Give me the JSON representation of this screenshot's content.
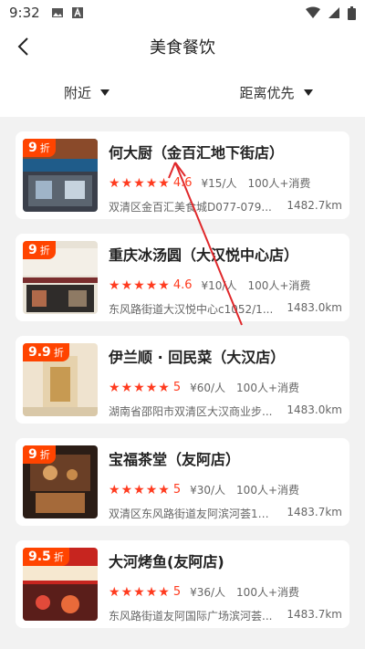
{
  "status": {
    "time": "9:32"
  },
  "nav": {
    "title": "美食餐饮"
  },
  "filters": {
    "left": "附近",
    "right": "距离优先"
  },
  "restaurants": [
    {
      "name": "何大厨（金百汇地下街店）",
      "discount": "9",
      "discount_unit": "折",
      "rating": "4.6",
      "price": "¥15/人",
      "consumption": "100人+消费",
      "address": "双清区金百汇美食城D077-079...",
      "distance": "1482.7km"
    },
    {
      "name": "重庆冰汤圆（大汉悦中心店）",
      "discount": "9",
      "discount_unit": "折",
      "rating": "4.6",
      "price": "¥10/人",
      "consumption": "100人+消费",
      "address": "东风路街道大汉悦中心c1052/1...",
      "distance": "1483.0km"
    },
    {
      "name": "伊兰顺 · 回民菜（大汉店）",
      "discount": "9.9",
      "discount_unit": "折",
      "rating": "5",
      "price": "¥60/人",
      "consumption": "100人+消费",
      "address": "湖南省邵阳市双清区大汉商业步...",
      "distance": "1483.0km"
    },
    {
      "name": "宝福茶堂（友阿店）",
      "discount": "9",
      "discount_unit": "折",
      "rating": "5",
      "price": "¥30/人",
      "consumption": "100人+消费",
      "address": "双清区东风路街道友阿滨河荟10...",
      "distance": "1483.7km"
    },
    {
      "name": "大河烤鱼(友阿店)",
      "discount": "9.5",
      "discount_unit": "折",
      "rating": "5",
      "price": "¥36/人",
      "consumption": "100人+消费",
      "address": "东风路街道友阿国际广场滨河荟...",
      "distance": "1483.7km"
    }
  ],
  "colors": {
    "accent": "#ff3b1f",
    "badge": "#ff4400",
    "arrow": "#e0282b"
  },
  "icons": {
    "back": "back-arrow-icon",
    "caret": "caret-down-icon",
    "star": "star-icon"
  }
}
